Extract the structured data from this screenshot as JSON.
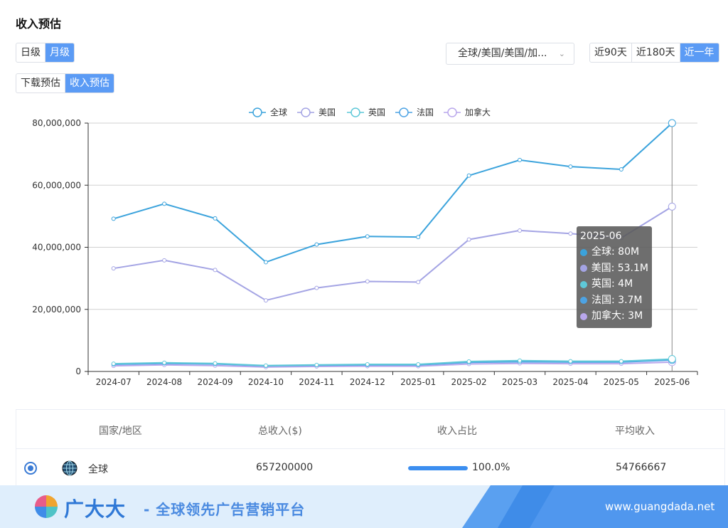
{
  "header": {
    "title": "收入预估"
  },
  "granularity": {
    "options": [
      "日级",
      "月级"
    ],
    "active": 1
  },
  "metric_tabs": {
    "options": [
      "下载预估",
      "收入预估"
    ],
    "active": 1
  },
  "region_select": {
    "value": "全球/美国/美国/加...",
    "icon": "chevron-down-icon"
  },
  "range_tabs": {
    "options": [
      "近90天",
      "近180天",
      "近一年"
    ],
    "active": 2
  },
  "chart_data": {
    "type": "line",
    "categories": [
      "2024-07",
      "2024-08",
      "2024-09",
      "2024-10",
      "2024-11",
      "2024-12",
      "2025-01",
      "2025-02",
      "2025-03",
      "2025-04",
      "2025-05",
      "2025-06"
    ],
    "ylim": [
      0,
      80000000
    ],
    "yticks": [
      "0",
      "20,000,000",
      "40,000,000",
      "60,000,000",
      "80,000,000"
    ],
    "ytick_values": [
      0,
      20000000,
      40000000,
      60000000,
      80000000
    ],
    "grid": true,
    "legend_position": "top",
    "series": [
      {
        "name": "全球",
        "color": "#3ba3dc",
        "values": [
          49200000,
          54000000,
          49300000,
          35200000,
          40900000,
          43500000,
          43300000,
          63100000,
          68100000,
          66000000,
          65100000,
          80000000
        ]
      },
      {
        "name": "美国",
        "color": "#a4a4e4",
        "values": [
          33200000,
          35800000,
          32700000,
          22900000,
          26900000,
          29000000,
          28800000,
          42500000,
          45400000,
          44400000,
          43000000,
          53100000
        ]
      },
      {
        "name": "英国",
        "color": "#5ec8d8",
        "values": [
          2500000,
          2800000,
          2600000,
          1900000,
          2100000,
          2300000,
          2300000,
          3200000,
          3500000,
          3300000,
          3300000,
          4000000
        ]
      },
      {
        "name": "法国",
        "color": "#4da3e4",
        "values": [
          2300000,
          2600000,
          2400000,
          1800000,
          2000000,
          2100000,
          2100000,
          2900000,
          3100000,
          3000000,
          3000000,
          3700000
        ]
      },
      {
        "name": "加拿大",
        "color": "#b9a7ec",
        "values": [
          1800000,
          2100000,
          1900000,
          1400000,
          1600000,
          1700000,
          1700000,
          2400000,
          2600000,
          2500000,
          2500000,
          3000000
        ]
      }
    ],
    "tooltip": {
      "title": "2025-06",
      "index": 11,
      "rows": [
        {
          "label": "全球: 80M",
          "color": "#3ba3dc"
        },
        {
          "label": "美国: 53.1M",
          "color": "#a4a4e4"
        },
        {
          "label": "英国: 4M",
          "color": "#5ec8d8"
        },
        {
          "label": "法国: 3.7M",
          "color": "#4da3e4"
        },
        {
          "label": "加拿大: 3M",
          "color": "#b9a7ec"
        }
      ]
    }
  },
  "table": {
    "headers": [
      "国家/地区",
      "总收入($)",
      "收入占比",
      "平均收入"
    ],
    "rows": [
      {
        "country": "全球",
        "total": "657200000",
        "share": "100.0%",
        "share_value": 1.0,
        "average": "54766667",
        "icon": "globe-icon"
      }
    ]
  },
  "banner": {
    "brand": "广大大",
    "slogan": "- 全球领先广告营销平台",
    "url": "www.guangdada.net"
  }
}
